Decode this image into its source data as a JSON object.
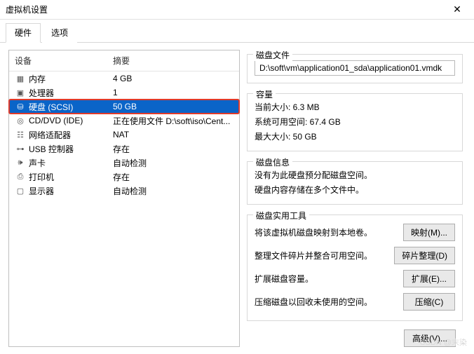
{
  "window": {
    "title": "虚拟机设置",
    "close_glyph": "✕"
  },
  "tabs": {
    "hardware": "硬件",
    "options": "选项"
  },
  "device_list": {
    "header_device": "设备",
    "header_summary": "摘要",
    "rows": [
      {
        "icon": "▦",
        "name": "内存",
        "summary": "4 GB",
        "icon_name": "memory-icon"
      },
      {
        "icon": "▣",
        "name": "处理器",
        "summary": "1",
        "icon_name": "cpu-icon"
      },
      {
        "icon": "⛁",
        "name": "硬盘 (SCSI)",
        "summary": "50 GB",
        "icon_name": "disk-icon",
        "selected": true,
        "highlighted": true
      },
      {
        "icon": "◎",
        "name": "CD/DVD (IDE)",
        "summary": "正在使用文件 D:\\soft\\iso\\Cent...",
        "icon_name": "cd-icon"
      },
      {
        "icon": "☷",
        "name": "网络适配器",
        "summary": "NAT",
        "icon_name": "network-icon"
      },
      {
        "icon": "⊶",
        "name": "USB 控制器",
        "summary": "存在",
        "icon_name": "usb-icon"
      },
      {
        "icon": "🕪",
        "name": "声卡",
        "summary": "自动检测",
        "icon_name": "sound-icon"
      },
      {
        "icon": "⎙",
        "name": "打印机",
        "summary": "存在",
        "icon_name": "printer-icon"
      },
      {
        "icon": "▢",
        "name": "显示器",
        "summary": "自动检测",
        "icon_name": "display-icon"
      }
    ]
  },
  "disk_file": {
    "title": "磁盘文件",
    "path": "D:\\soft\\vm\\application01_sda\\application01.vmdk"
  },
  "capacity": {
    "title": "容量",
    "current": "当前大小: 6.3 MB",
    "free": "系统可用空间: 67.4 GB",
    "max": "最大大小: 50 GB"
  },
  "disk_info": {
    "title": "磁盘信息",
    "line1": "没有为此硬盘预分配磁盘空间。",
    "line2": "硬盘内容存储在多个文件中。"
  },
  "utilities": {
    "title": "磁盘实用工具",
    "map_text": "将该虚拟机磁盘映射到本地卷。",
    "map_btn": "映射(M)...",
    "defrag_text": "整理文件碎片并整合可用空间。",
    "defrag_btn": "碎片整理(D)",
    "expand_text": "扩展磁盘容量。",
    "expand_btn": "扩展(E)...",
    "compact_text": "压缩磁盘以回收未使用的空间。",
    "compact_btn": "压缩(C)"
  },
  "advanced_btn": "高级(V)...",
  "watermark": "CSDN @末染"
}
